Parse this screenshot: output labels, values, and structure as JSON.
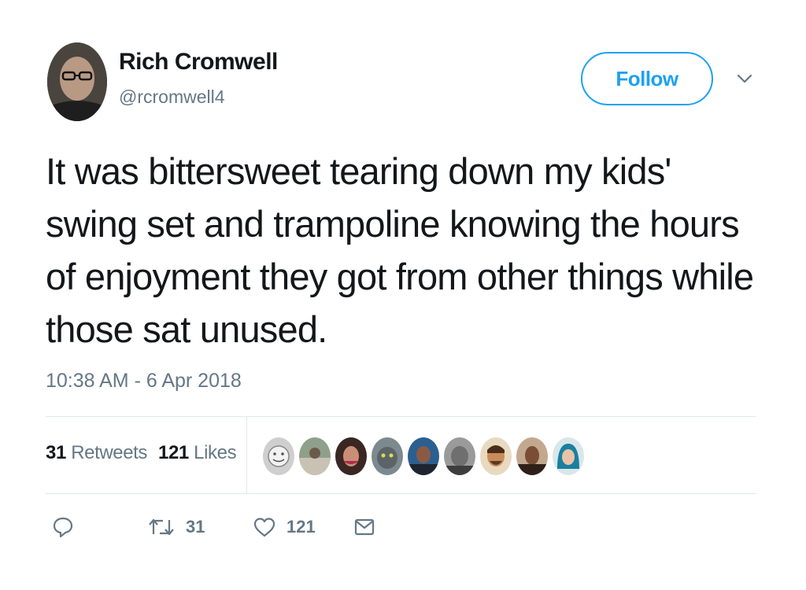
{
  "author": {
    "name": "Rich Cromwell",
    "handle": "@rcromwell4"
  },
  "follow_button": {
    "label": "Follow"
  },
  "tweet": {
    "text_lines": [
      "It was bittersweet tearing down my kids'",
      "swing set and trampoline knowing the hours",
      "of enjoyment they got from other things while",
      "those sat unused."
    ],
    "timestamp": "10:38 AM - 6 Apr 2018"
  },
  "stats": {
    "retweets_count": "31",
    "retweets_label": "Retweets",
    "likes_count": "121",
    "likes_label": "Likes"
  },
  "actions": {
    "retweet_count": "31",
    "like_count": "121"
  },
  "icons": {
    "reply": "reply-icon",
    "retweet": "retweet-icon",
    "like": "heart-icon",
    "dm": "envelope-icon",
    "more": "chevron-down-icon"
  },
  "colors": {
    "accent": "#1da1f2",
    "secondary_text": "#657786",
    "primary_text": "#14171a",
    "divider": "#e1e8ed"
  }
}
